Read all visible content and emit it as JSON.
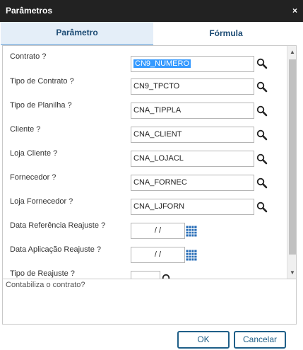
{
  "window": {
    "title": "Parâmetros",
    "close_glyph": "×"
  },
  "tabs": [
    {
      "label": "Parâmetro",
      "active": true
    },
    {
      "label": "Fórmula",
      "active": false
    }
  ],
  "fields": [
    {
      "label": "Contrato ?",
      "value": "CN9_NUMERO",
      "type": "text",
      "selected": true,
      "icon": "search-icon"
    },
    {
      "label": "Tipo de Contrato ?",
      "value": "CN9_TPCTO",
      "type": "text",
      "icon": "search-icon"
    },
    {
      "label": "Tipo de Planilha ?",
      "value": "CNA_TIPPLA",
      "type": "text",
      "icon": "search-icon"
    },
    {
      "label": "Cliente ?",
      "value": "CNA_CLIENT",
      "type": "text",
      "icon": "search-icon"
    },
    {
      "label": "Loja Cliente ?",
      "value": "CNA_LOJACL",
      "type": "text",
      "icon": "search-icon"
    },
    {
      "label": "Fornecedor ?",
      "value": "CNA_FORNEC",
      "type": "text",
      "icon": "search-icon"
    },
    {
      "label": "Loja Fornecedor ?",
      "value": "CNA_LJFORN",
      "type": "text",
      "icon": "search-icon"
    },
    {
      "label": "Data Referência Reajuste ?",
      "value": "/ /",
      "type": "date",
      "icon": "calendar-icon"
    },
    {
      "label": "Data Aplicação Reajuste ?",
      "value": "/ /",
      "type": "date",
      "icon": "calendar-icon"
    },
    {
      "label": "Tipo de Reajuste ?",
      "value": "",
      "type": "small",
      "icon": "search-icon"
    }
  ],
  "help": {
    "text": "Contabiliza o contrato?"
  },
  "buttons": {
    "ok_label": "OK",
    "cancel_label": "Cancelar"
  },
  "colors": {
    "titlebar": "#222222",
    "tab_active_bg": "#e4eef8",
    "accent": "#1f5f88",
    "selection": "#3399ff",
    "calendar": "#2a6fb8"
  }
}
